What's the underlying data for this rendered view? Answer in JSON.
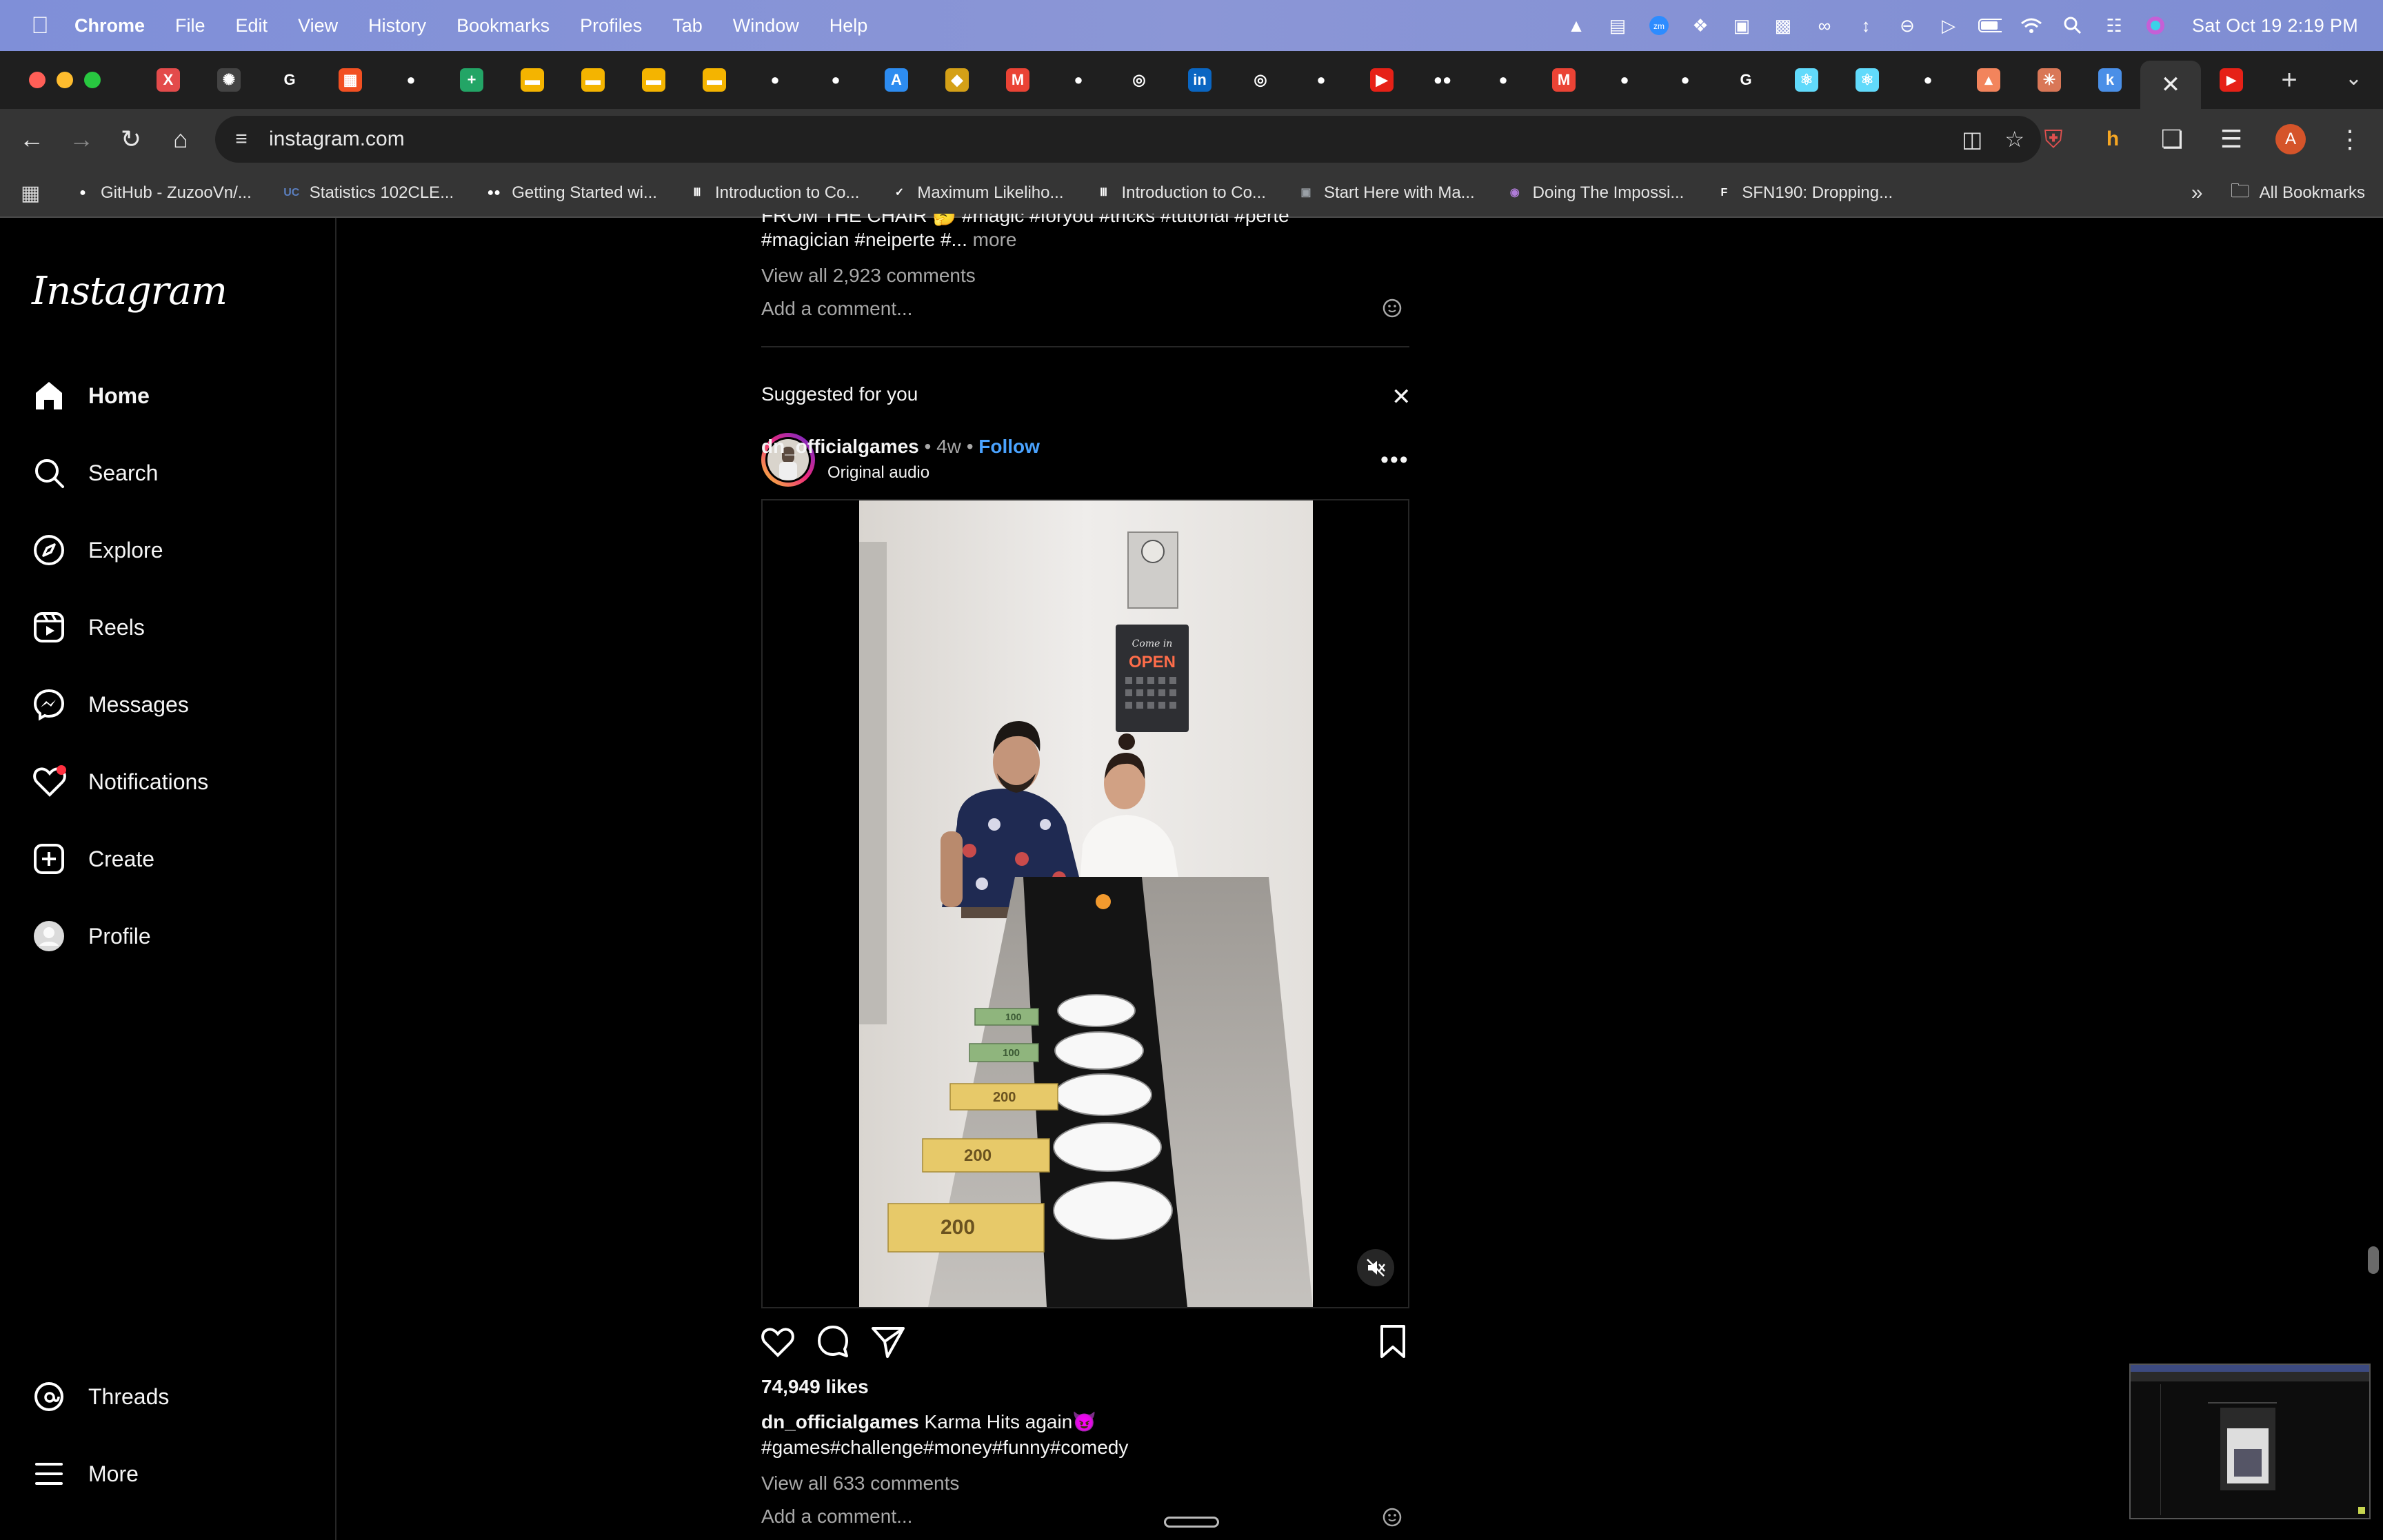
{
  "menubar": {
    "app": "Chrome",
    "menus": [
      "File",
      "Edit",
      "View",
      "History",
      "Bookmarks",
      "Profiles",
      "Tab",
      "Window",
      "Help"
    ],
    "clock": "Sat Oct 19  2:19 PM"
  },
  "browser": {
    "url": "instagram.com",
    "profile_initial": "A",
    "tabs": [
      {
        "icon": "x-icon",
        "color": "#e34b4b",
        "glyph": "X"
      },
      {
        "icon": "openai-icon",
        "color": "#444",
        "glyph": "✺"
      },
      {
        "icon": "google-icon",
        "color": "#ffffff",
        "glyph": "G"
      },
      {
        "icon": "microsoft-icon",
        "color": "#f25022",
        "glyph": "▦"
      },
      {
        "icon": "github-icon",
        "color": "#ffffff",
        "glyph": "●"
      },
      {
        "icon": "sheets-icon",
        "color": "#23a566",
        "glyph": "+"
      },
      {
        "icon": "slides-icon",
        "color": "#f4b400",
        "glyph": "▬"
      },
      {
        "icon": "slides-icon",
        "color": "#f4b400",
        "glyph": "▬"
      },
      {
        "icon": "slides-icon",
        "color": "#f4b400",
        "glyph": "▬"
      },
      {
        "icon": "slides-icon",
        "color": "#f4b400",
        "glyph": "▬"
      },
      {
        "icon": "github-icon",
        "color": "#ffffff",
        "glyph": "●"
      },
      {
        "icon": "github-icon",
        "color": "#ffffff",
        "glyph": "●"
      },
      {
        "icon": "appstore-icon",
        "color": "#2d8cf0",
        "glyph": "A"
      },
      {
        "icon": "shield-icon",
        "color": "#d4a017",
        "glyph": "◆"
      },
      {
        "icon": "gmail-icon",
        "color": "#ea4335",
        "glyph": "M"
      },
      {
        "icon": "github-icon",
        "color": "#ffffff",
        "glyph": "●"
      },
      {
        "icon": "chrome-icon",
        "color": "#ffffff",
        "glyph": "◎"
      },
      {
        "icon": "linkedin-icon",
        "color": "#0a66c2",
        "glyph": "in"
      },
      {
        "icon": "chrome-icon",
        "color": "#ffffff",
        "glyph": "◎"
      },
      {
        "icon": "github-icon",
        "color": "#ffffff",
        "glyph": "●"
      },
      {
        "icon": "youtube-icon",
        "color": "#e62117",
        "glyph": "▶"
      },
      {
        "icon": "medium-icon",
        "color": "#ffffff",
        "glyph": "●●"
      },
      {
        "icon": "github-icon",
        "color": "#ffffff",
        "glyph": "●"
      },
      {
        "icon": "gmail-icon",
        "color": "#ea4335",
        "glyph": "M"
      },
      {
        "icon": "github-icon",
        "color": "#ffffff",
        "glyph": "●"
      },
      {
        "icon": "github-icon",
        "color": "#ffffff",
        "glyph": "●"
      },
      {
        "icon": "google-icon",
        "color": "#ffffff",
        "glyph": "G"
      },
      {
        "icon": "react-icon",
        "color": "#61dafb",
        "glyph": "⚛"
      },
      {
        "icon": "react-icon",
        "color": "#61dafb",
        "glyph": "⚛"
      },
      {
        "icon": "github-icon",
        "color": "#ffffff",
        "glyph": "●"
      },
      {
        "icon": "sourcegraph-icon",
        "color": "#f2845c",
        "glyph": "▴"
      },
      {
        "icon": "claude-icon",
        "color": "#d97757",
        "glyph": "✳"
      },
      {
        "icon": "k-icon",
        "color": "#4a8fe7",
        "glyph": "k"
      }
    ]
  },
  "bookmarks": [
    {
      "label": "GitHub - ZuzooVn/...",
      "icon": "github-icon",
      "color": "#ffffff",
      "glyph": "●"
    },
    {
      "label": "Statistics 102CLE...",
      "icon": "ucla-icon",
      "color": "#5b7fbf",
      "glyph": "UC"
    },
    {
      "label": "Getting Started wi...",
      "icon": "medium-icon",
      "color": "#ffffff",
      "glyph": "●●"
    },
    {
      "label": "Introduction to Co...",
      "icon": "mit-icon",
      "color": "#ffffff",
      "glyph": "Ⅲ"
    },
    {
      "label": "Maximum Likeliho...",
      "icon": "doc-icon",
      "color": "#ffffff",
      "glyph": "✓"
    },
    {
      "label": "Introduction to Co...",
      "icon": "mit-icon",
      "color": "#ffffff",
      "glyph": "Ⅲ"
    },
    {
      "label": "Start Here with Ma...",
      "icon": "book-icon",
      "color": "#9aa0a6",
      "glyph": "▣"
    },
    {
      "label": "Doing The Impossi...",
      "icon": "globe-icon",
      "color": "#b07cd8",
      "glyph": "◉"
    },
    {
      "label": "SFN190: Dropping...",
      "icon": "f-icon",
      "color": "#ffffff",
      "glyph": "F"
    }
  ],
  "all_bookmarks": "All Bookmarks",
  "instagram": {
    "logo": "Instagram",
    "nav": [
      {
        "label": "Home",
        "icon": "home-icon"
      },
      {
        "label": "Search",
        "icon": "search-icon"
      },
      {
        "label": "Explore",
        "icon": "explore-icon"
      },
      {
        "label": "Reels",
        "icon": "reels-icon"
      },
      {
        "label": "Messages",
        "icon": "messages-icon"
      },
      {
        "label": "Notifications",
        "icon": "heart-icon"
      },
      {
        "label": "Create",
        "icon": "create-icon"
      },
      {
        "label": "Profile",
        "icon": "profile-icon"
      }
    ],
    "threads": "Threads",
    "more": "More"
  },
  "prev_post": {
    "caption_partial": "FROM THE CHAIR 🤔 #magic #foryou #tricks #tutorial #perte",
    "caption_line2": "#magician #neiperte #...",
    "more": "more",
    "comments": "View all 2,923 comments",
    "add_comment": "Add a comment..."
  },
  "suggested": {
    "heading": "Suggested for you",
    "username": "dn_officialgames",
    "age": "4w",
    "follow": "Follow",
    "audio": "Original audio",
    "likes": "74,949 likes",
    "caption_user": "dn_officialgames",
    "caption": "Karma Hits again😈",
    "hashtags": "#games#challenge#money#funny#comedy",
    "comments": "View all 633 comments",
    "add_comment": "Add a comment...",
    "video_props": {
      "sign_top": "Come in",
      "sign_main": "OPEN",
      "bills": [
        "100",
        "100",
        "200",
        "200",
        "200"
      ]
    }
  }
}
